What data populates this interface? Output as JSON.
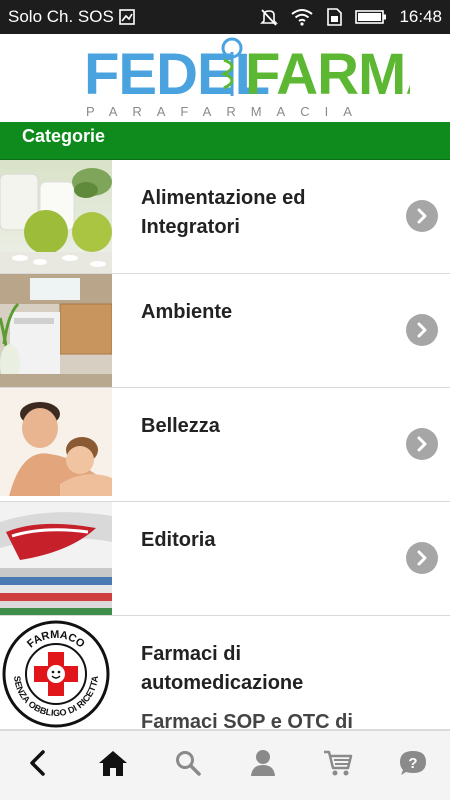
{
  "status": {
    "carrier": "Solo Ch. SOS",
    "time": "16:48"
  },
  "logo": {
    "left_word": "FEDEL",
    "right_word": "FARMA",
    "tagline": "PARAFARMACIA"
  },
  "categories_header": "Categorie",
  "categories": [
    {
      "label": "Alimentazione ed Integratori"
    },
    {
      "label": "Ambiente"
    },
    {
      "label": "Bellezza"
    },
    {
      "label": "Editoria"
    },
    {
      "label": "Farmaci di automedicazione"
    }
  ],
  "next_peek": "Farmaci SOP e OTC di",
  "badge": {
    "top_text": "FARMACO",
    "bottom_text": "SENZA OBBLIGO DI RICETTA"
  },
  "nav": [
    "back-icon",
    "home-icon",
    "search-icon",
    "user-icon",
    "cart-icon",
    "help-icon"
  ],
  "colors": {
    "green": "#0f8a1c",
    "logo_blue": "#4aa3df",
    "logo_green": "#5cb832",
    "chevron": "#a6a6a6"
  }
}
